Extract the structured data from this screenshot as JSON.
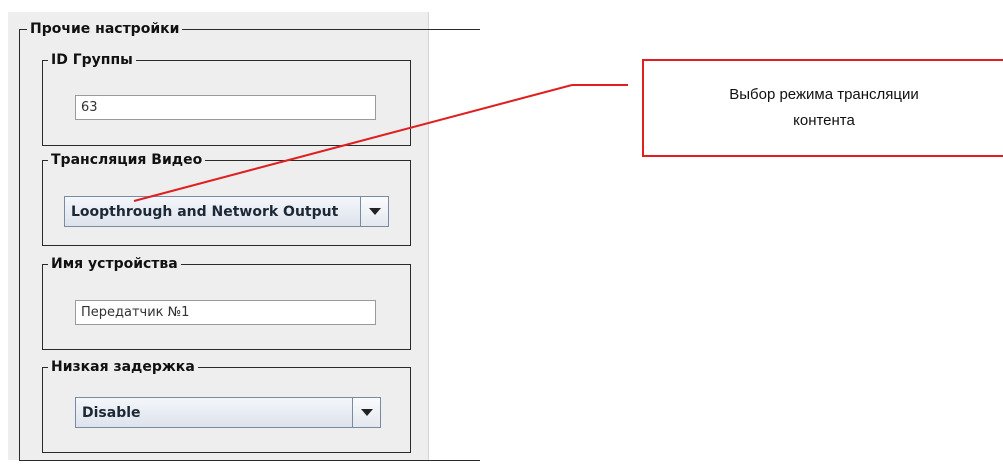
{
  "other_settings": {
    "title": "Прочие настройки"
  },
  "group_id": {
    "title": "ID Группы",
    "value": "63"
  },
  "video_transmission": {
    "title": "Трансляция Видео",
    "selected": "Loopthrough and Network Output"
  },
  "device_name": {
    "title": "Имя устройства",
    "value": "Передатчик №1"
  },
  "low_latency": {
    "title": "Низкая задержка",
    "selected": "Disable"
  },
  "callout": {
    "text": "Выбор режима трансляции контента"
  },
  "colors": {
    "annotation": "#e02020",
    "combo_text": "#1c2836"
  }
}
